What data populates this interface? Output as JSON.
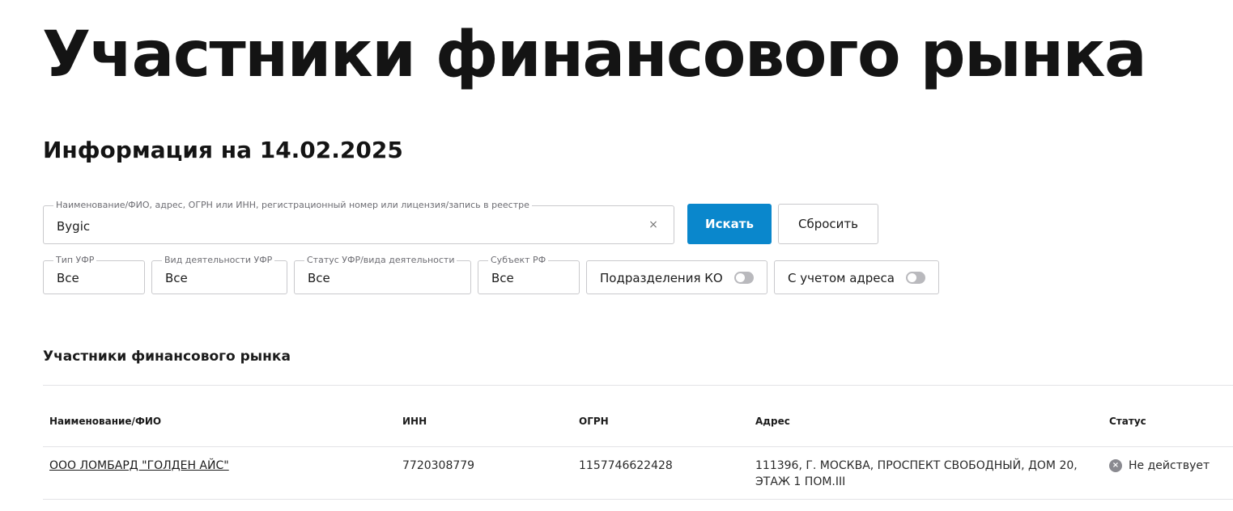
{
  "page": {
    "title": "Участники финансового рынка",
    "info_date": "Информация на 14.02.2025"
  },
  "search": {
    "legend": "Наименование/ФИО, адрес, ОГРН или ИНН, регистрационный номер или лицензия/запись в реестре",
    "value": "Bygic",
    "clear_icon": "×",
    "search_button": "Искать",
    "reset_button": "Сбросить"
  },
  "filters": [
    {
      "legend": "Тип УФР",
      "value": "Все"
    },
    {
      "legend": "Вид деятельности УФР",
      "value": "Все"
    },
    {
      "legend": "Статус УФР/вида деятельности",
      "value": "Все"
    },
    {
      "legend": "Субъект РФ",
      "value": "Все"
    }
  ],
  "toggles": [
    {
      "label": "Подразделения КО",
      "state": "off"
    },
    {
      "label": "С учетом адреса",
      "state": "off"
    }
  ],
  "results": {
    "section_title": "Участники финансового рынка",
    "columns": [
      "Наименование/ФИО",
      "ИНН",
      "ОГРН",
      "Адрес",
      "Статус"
    ],
    "rows": [
      {
        "name": "ООО ЛОМБАРД \"ГОЛДЕН АЙС\"",
        "inn": "7720308779",
        "ogrn": "1157746622428",
        "address": "111396, Г. МОСКВА, ПРОСПЕКТ СВОБОДНЫЙ, ДОМ 20, ЭТАЖ 1 ПОМ.III",
        "status": "Не действует",
        "status_icon": "×"
      }
    ]
  },
  "colors": {
    "accent": "#0a87cc",
    "border": "#c9c9cc",
    "status_inactive": "#8a8a90"
  }
}
